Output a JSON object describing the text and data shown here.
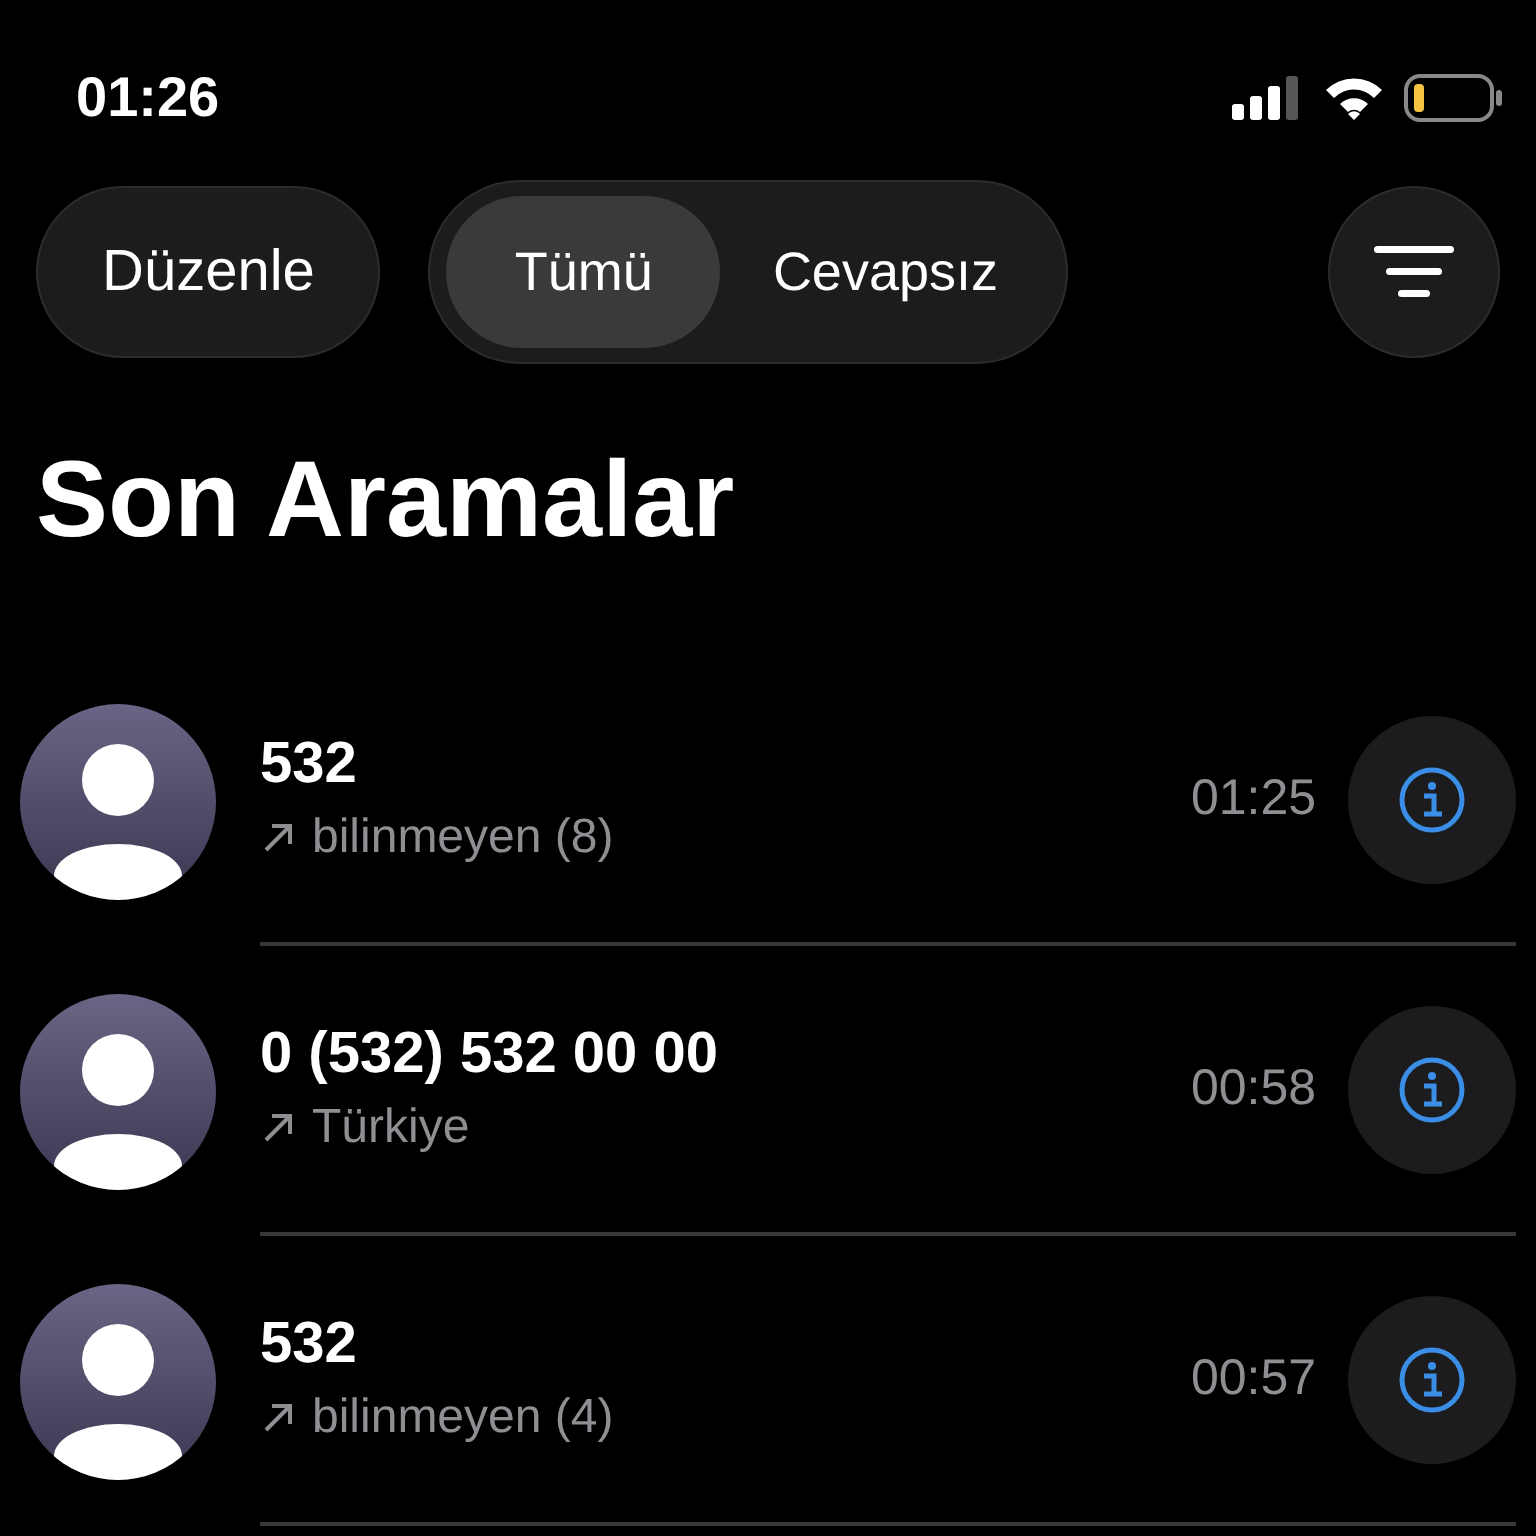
{
  "status_bar": {
    "time": "01:26"
  },
  "toolbar": {
    "edit_button": "Düzenle",
    "tabs": [
      {
        "label": "Tümü",
        "selected": true
      },
      {
        "label": "Cevapsız",
        "selected": false
      }
    ]
  },
  "title": "Son Aramalar",
  "calls": [
    {
      "name": "532",
      "detail": "bilinmeyen (8)",
      "time": "01:25"
    },
    {
      "name": "0 (532) 532 00 00",
      "detail": "Türkiye",
      "time": "00:58"
    },
    {
      "name": "532",
      "detail": "bilinmeyen (4)",
      "time": "00:57"
    }
  ]
}
